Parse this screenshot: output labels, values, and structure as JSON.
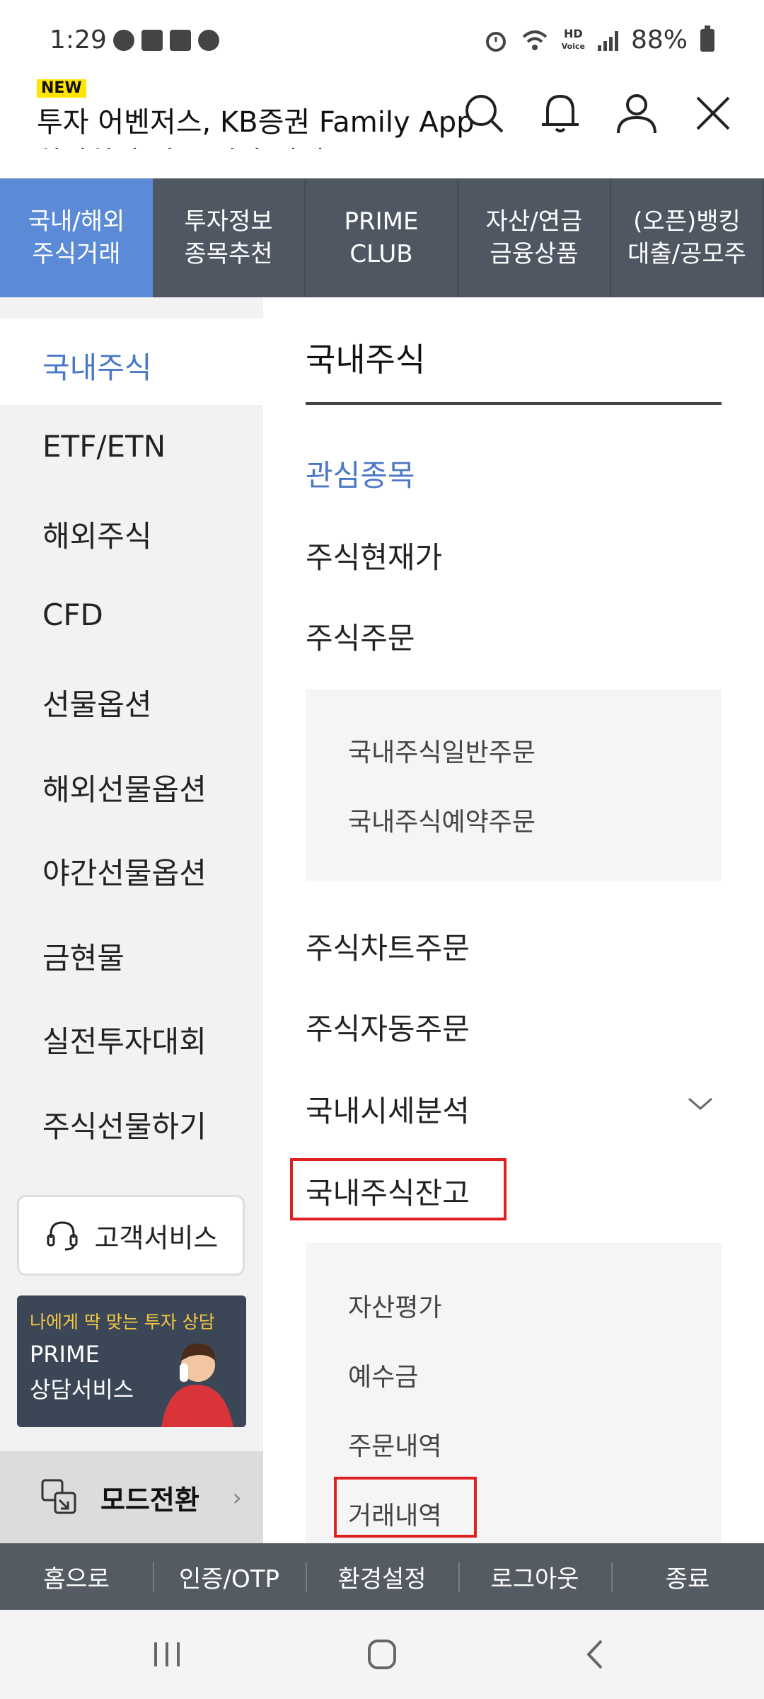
{
  "status": {
    "time": "1:29",
    "battery": "88%",
    "hd_label": "HD",
    "voice_label": "Voice"
  },
  "header": {
    "badge": "NEW",
    "title": "투자 어벤저스, KB증권 Family App",
    "subtitle": "하나하나 아주 뭔가 있게"
  },
  "tabs": [
    {
      "line1": "국내/해외",
      "line2": "주식거래"
    },
    {
      "line1": "투자정보",
      "line2": "종목추천"
    },
    {
      "line1": "PRIME",
      "line2": "CLUB"
    },
    {
      "line1": "자산/연금",
      "line2": "금융상품"
    },
    {
      "line1": "(오픈)뱅킹",
      "line2": "대출/공모주"
    }
  ],
  "sidebar": {
    "items": [
      "국내주식",
      "ETF/ETN",
      "해외주식",
      "CFD",
      "선물옵션",
      "해외선물옵션",
      "야간선물옵션",
      "금현물",
      "실전투자대회",
      "주식선물하기"
    ],
    "customer_service": "고객서비스",
    "banner": {
      "top": "나에게 딱 맞는 투자 상담",
      "line1": "PRIME",
      "line2": "상담서비스"
    },
    "mode_switch": "모드전환"
  },
  "content": {
    "title": "국내주식",
    "menu": {
      "watchlist": "관심종목",
      "current_price": "주식현재가",
      "order": "주식주문",
      "order_subs": [
        "국내주식일반주문",
        "국내주식예약주문"
      ],
      "chart_order": "주식차트주문",
      "auto_order": "주식자동주문",
      "market_analysis": "국내시세분석",
      "balance": "국내주식잔고",
      "balance_subs": [
        "자산평가",
        "예수금",
        "주문내역",
        "거래내역"
      ]
    }
  },
  "footer": [
    "홈으로",
    "인증/OTP",
    "환경설정",
    "로그아웃",
    "종료"
  ],
  "colors": {
    "accent": "#5b8ad6",
    "highlight": "#e02020",
    "nav_bg": "#4f5763"
  }
}
